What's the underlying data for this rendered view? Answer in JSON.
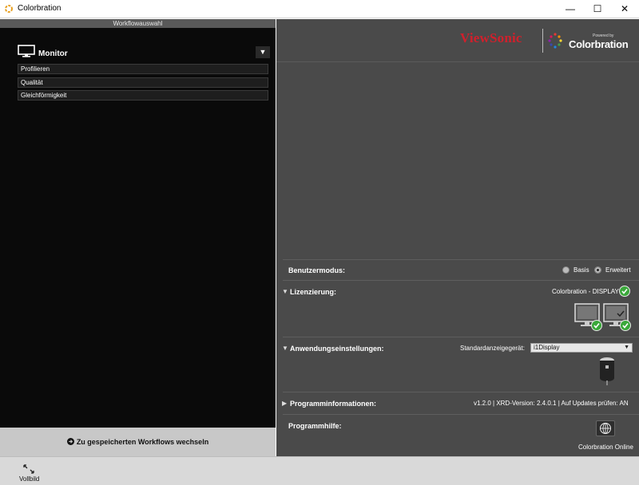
{
  "window": {
    "title": "Colorbration",
    "icon": "colorbration-app-icon",
    "controls": {
      "minimize": "—",
      "maximize": "☐",
      "close": "✕"
    }
  },
  "left": {
    "header": "Workflowauswahl",
    "group": {
      "label": "Monitor",
      "icon": "monitor-icon",
      "toggle": "▼"
    },
    "items": [
      "Profilieren",
      "Qualität",
      "Gleichförmigkeit"
    ],
    "footer": {
      "icon": "arrow-circle-icon",
      "label": "Zu gespeicherten Workflows wechseln"
    }
  },
  "right": {
    "logo": {
      "brand": "ViewSonic",
      "product": "Colorbration",
      "powered": "Powered by"
    },
    "benutzermodus": {
      "label": "Benutzermodus:",
      "options": [
        "Basis",
        "Erweitert"
      ],
      "selected": "Erweitert"
    },
    "lizenzierung": {
      "label": "Lizenzierung:",
      "status": "Colorbration - DISPLAY",
      "toggle": "▼"
    },
    "anwendung": {
      "label": "Anwendungseinstellungen:",
      "toggle": "▼",
      "device_label": "Standardanzeigegerät:",
      "device_value": "i1Display"
    },
    "programminfo": {
      "label": "Programminformationen:",
      "toggle": "▶",
      "value": "v1.2.0 | XRD-Version: 2.4.0.1 | Auf Updates prüfen: AN"
    },
    "programmhilfe": {
      "label": "Programmhilfe:",
      "link": "Colorbration Online"
    }
  },
  "bottom": {
    "fullscreen_label": "Vollbild",
    "icon": "fullscreen-icon"
  },
  "colors": {
    "left_bg": "#0a0a0a",
    "right_bg": "#4a4a4a",
    "brand_red": "#d0202c",
    "check_green": "#3aa83a"
  }
}
